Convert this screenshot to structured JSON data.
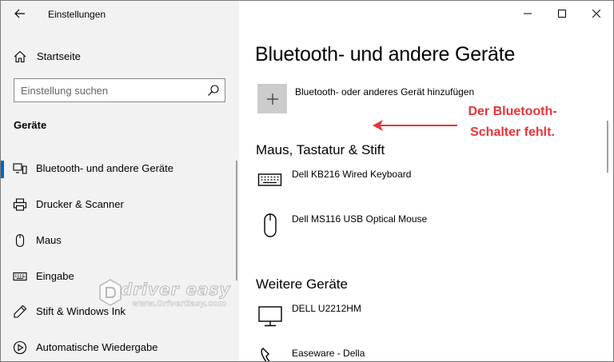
{
  "window": {
    "app_title": "Einstellungen",
    "controls": [
      "minimize-icon",
      "maximize-icon",
      "close-icon"
    ]
  },
  "sidebar": {
    "home_label": "Startseite",
    "search_placeholder": "Einstellung suchen",
    "section_title": "Geräte",
    "items": [
      {
        "label": "Bluetooth- und andere Geräte",
        "icon": "bluetooth-devices-icon",
        "active": true
      },
      {
        "label": "Drucker & Scanner",
        "icon": "printer-icon",
        "active": false
      },
      {
        "label": "Maus",
        "icon": "mouse-icon",
        "active": false
      },
      {
        "label": "Eingabe",
        "icon": "keyboard-icon",
        "active": false
      },
      {
        "label": "Stift & Windows Ink",
        "icon": "pen-icon",
        "active": false
      },
      {
        "label": "Automatische Wiedergabe",
        "icon": "autoplay-icon",
        "active": false
      }
    ]
  },
  "main": {
    "title": "Bluetooth- und andere Geräte",
    "add_device_label": "Bluetooth- oder anderes Gerät hinzufügen",
    "groups": [
      {
        "title": "Maus, Tastatur & Stift",
        "devices": [
          {
            "name": "Dell KB216 Wired Keyboard",
            "icon": "keyboard-device-icon"
          },
          {
            "name": "Dell MS116 USB Optical Mouse",
            "icon": "mouse-device-icon"
          }
        ]
      },
      {
        "title": "Weitere Geräte",
        "devices": [
          {
            "name": "DELL U2212HM",
            "icon": "monitor-icon"
          },
          {
            "name": "Easeware - Della",
            "icon": "phone-icon"
          }
        ]
      }
    ]
  },
  "annotation": {
    "line1": "Der Bluetooth-",
    "line2": "Schalter fehlt.",
    "color": "#e8333a"
  },
  "watermark": {
    "text": "driver easy",
    "url": "www.DriverEasy.com"
  },
  "colors": {
    "sidebar_bg": "#f2f2f2",
    "accent": "#0067c0",
    "add_button_bg": "#cccccc"
  }
}
